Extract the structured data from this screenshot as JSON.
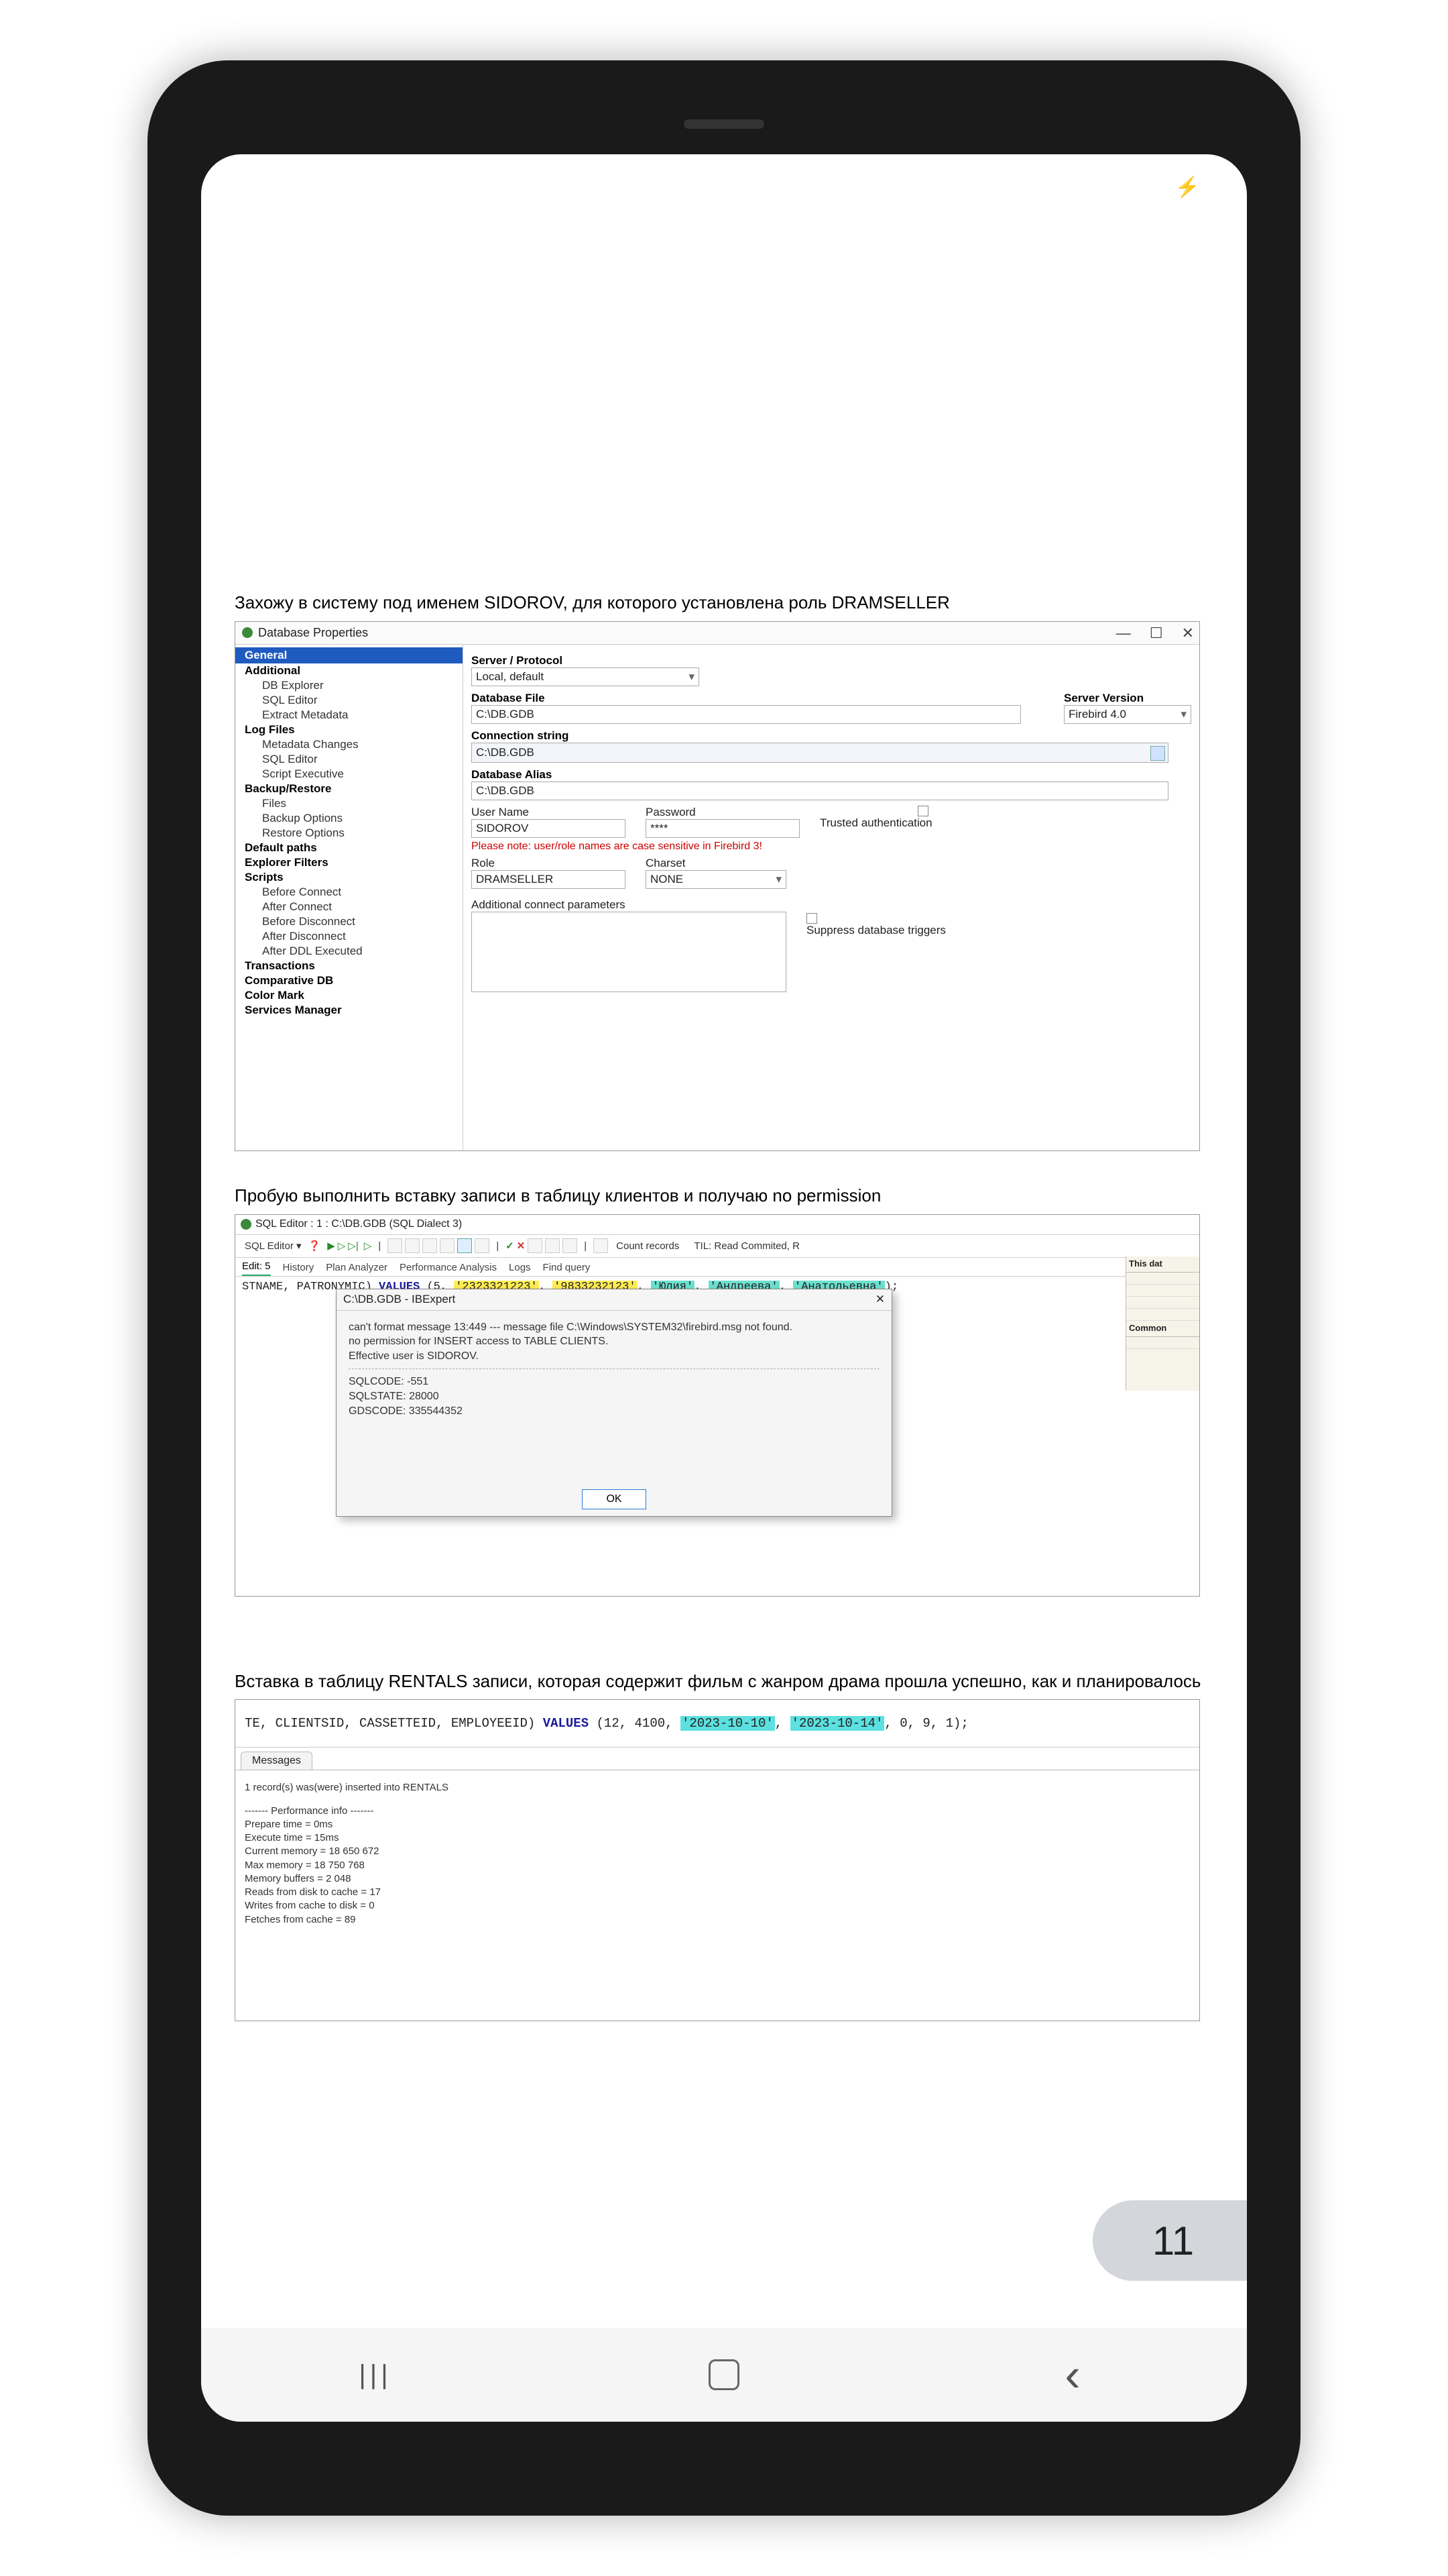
{
  "status": {
    "icon": "bolt"
  },
  "section1": {
    "heading": "Захожу в систему под именем SIDOROV, для которого установлена роль DRAMSELLER",
    "title": "Database Properties",
    "tree_sel": "General",
    "tree": [
      [
        "b",
        "Additional"
      ],
      [
        "i",
        "DB Explorer"
      ],
      [
        "i",
        "SQL Editor"
      ],
      [
        "i",
        "Extract Metadata"
      ],
      [
        "b",
        "Log Files"
      ],
      [
        "i",
        "Metadata Changes"
      ],
      [
        "i",
        "SQL Editor"
      ],
      [
        "i",
        "Script Executive"
      ],
      [
        "b",
        "Backup/Restore"
      ],
      [
        "i",
        "Files"
      ],
      [
        "i",
        "Backup Options"
      ],
      [
        "i",
        "Restore Options"
      ],
      [
        "b",
        "Default paths"
      ],
      [
        "b",
        "Explorer Filters"
      ],
      [
        "b",
        "Scripts"
      ],
      [
        "i",
        "Before Connect"
      ],
      [
        "i",
        "After Connect"
      ],
      [
        "i",
        "Before Disconnect"
      ],
      [
        "i",
        "After Disconnect"
      ],
      [
        "i",
        "After DDL Executed"
      ],
      [
        "b",
        "Transactions"
      ],
      [
        "b",
        "Comparative DB"
      ],
      [
        "b",
        "Color Mark"
      ],
      [
        "b",
        "Services Manager"
      ]
    ],
    "labels": {
      "server_protocol": "Server / Protocol",
      "server_value": "Local, default",
      "db_file": "Database File",
      "db_file_value": "C:\\DB.GDB",
      "server_version": "Server Version",
      "server_version_value": "Firebird 4.0",
      "conn_string": "Connection string",
      "conn_string_value": "C:\\DB.GDB",
      "db_alias": "Database Alias",
      "db_alias_value": "C:\\DB.GDB",
      "username": "User Name",
      "username_value": "SIDOROV",
      "password": "Password",
      "password_value": "****",
      "trusted_auth": "Trusted authentication",
      "warn": "Please note: user/role names are case sensitive in Firebird 3!",
      "role": "Role",
      "role_value": "DRAMSELLER",
      "charset": "Charset",
      "charset_value": "NONE",
      "addl_params": "Additional connect parameters",
      "suppress": "Suppress database triggers"
    }
  },
  "section2": {
    "heading": "Пробую выполнить вставку записи в таблицу клиентов и получаю no permission",
    "title": "SQL Editor : 1 : C:\\DB.GDB (SQL Dialect 3)",
    "toolbar_left": "SQL Editor ▾",
    "toolbar_right_count": "Count records",
    "toolbar_right_til": "TIL: Read Commited, R",
    "tabs": [
      "Edit: 5",
      "History",
      "Plan Analyzer",
      "Performance Analysis",
      "Logs",
      "Find query"
    ],
    "code_prefix": "STNAME, PATRONYMIC) ",
    "code_kw": "VALUES",
    "code_args": " (5, ",
    "code_hl1": "'2323321223'",
    "code_hl2": "'9833232123'",
    "code_hl3": "'Юлия'",
    "code_hl4": "'Андреева'",
    "code_hl5": "'Анатольевна'",
    "code_end": ");",
    "side_hdr1": "This dat",
    "side_hdr2": "Common",
    "side_items": [
      "…",
      "…",
      "…",
      "…",
      "…"
    ],
    "err_title": "C:\\DB.GDB - IBExpert",
    "err_line1": "can't format message 13:449 --- message file C:\\Windows\\SYSTEM32\\firebird.msg not found.",
    "err_line2": "no permission for INSERT access to TABLE CLIENTS.",
    "err_line3": "Effective user is SIDOROV.",
    "err_line4": "SQLCODE: -551",
    "err_line5": "SQLSTATE: 28000",
    "err_line6": "GDSCODE: 335544352",
    "ok": "OK"
  },
  "section3": {
    "heading": "Вставка в таблицу RENTALS записи, которая содержит фильм с жанром драма прошла успешно, как и планировалось",
    "code_prefix": "TE, CLIENTSID, CASSETTEID, EMPLOYEEID) ",
    "code_kw": "VALUES",
    "code_args": " (12, 4100, ",
    "code_hl1": "'2023-10-10'",
    "code_hl2": "'2023-10-14'",
    "code_end": ", 0, 9, 1);",
    "msg_tab": "Messages",
    "msg_line1": "1 record(s) was(were) inserted into RENTALS",
    "perf_header": "------- Performance info -------",
    "perf": [
      "Prepare time = 0ms",
      "Execute time = 15ms",
      "Current memory = 18 650 672",
      "Max memory = 18 750 768",
      "Memory buffers = 2 048",
      "Reads from disk to cache = 17",
      "Writes from cache to disk = 0",
      "Fetches from cache = 89"
    ]
  },
  "page_number": "11"
}
